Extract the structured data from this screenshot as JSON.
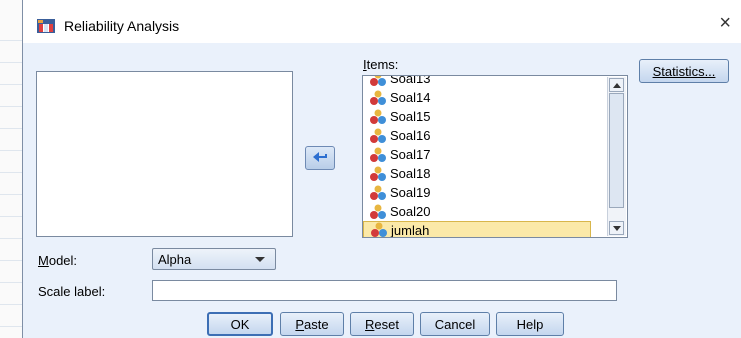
{
  "window": {
    "title": "Reliability Analysis",
    "close_glyph": "×"
  },
  "items": {
    "label": "Items:",
    "list": [
      "Soal13",
      "Soal14",
      "Soal15",
      "Soal16",
      "Soal17",
      "Soal18",
      "Soal19",
      "Soal20",
      "jumlah"
    ],
    "selected": "jumlah"
  },
  "buttons": {
    "statistics": "Statistics...",
    "ok": "OK",
    "paste": "Paste",
    "reset": "Reset",
    "cancel": "Cancel",
    "help": "Help"
  },
  "model": {
    "label": "Model:",
    "value": "Alpha"
  },
  "scale": {
    "label": "Scale label:",
    "value": ""
  },
  "colors": {
    "dialog_bg": "#eaf1fb",
    "selected_bg": "#fbe9a8",
    "accent": "#3c6eb4"
  }
}
